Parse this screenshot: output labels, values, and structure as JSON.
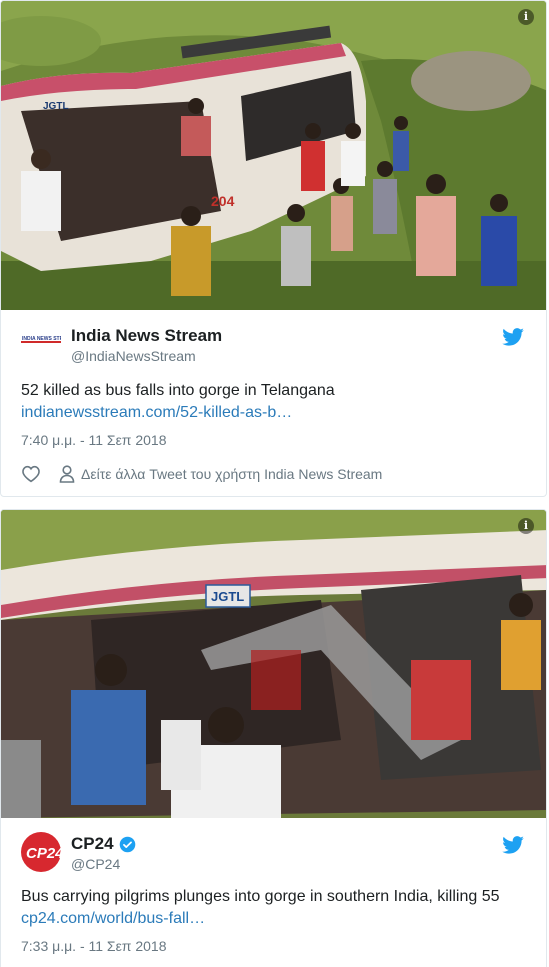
{
  "tweets": [
    {
      "author_name": "India News Stream",
      "author_handle": "@IndiaNewsStream",
      "avatar_label": "INDIA NEWS STREAM",
      "text": "52 killed as bus falls into gorge in Telangana",
      "link": "indianewsstream.com/52-killed-as-b…",
      "timestamp": "7:40 μ.μ. - 11 Σεπ 2018",
      "more_tweets": "Δείτε άλλα Tweet του χρήστη India News Stream",
      "bus_label": "JGTL",
      "bus_number": "204"
    },
    {
      "author_name": "CP24",
      "author_handle": "@CP24",
      "avatar_label": "CP24",
      "text": "Bus carrying pilgrims plunges into gorge in southern India, killing 55",
      "link": "cp24.com/world/bus-fall…",
      "timestamp": "7:33 μ.μ. - 11 Σεπ 2018",
      "bus_label": "JGTL"
    }
  ],
  "colors": {
    "link": "#2b7bb9",
    "twitter_blue": "#1da1f2",
    "cp24_red": "#d7282f",
    "muted": "#697882"
  },
  "icons": [
    "info-icon",
    "twitter-bird-icon",
    "heart-icon",
    "person-icon",
    "verified-badge-icon"
  ]
}
